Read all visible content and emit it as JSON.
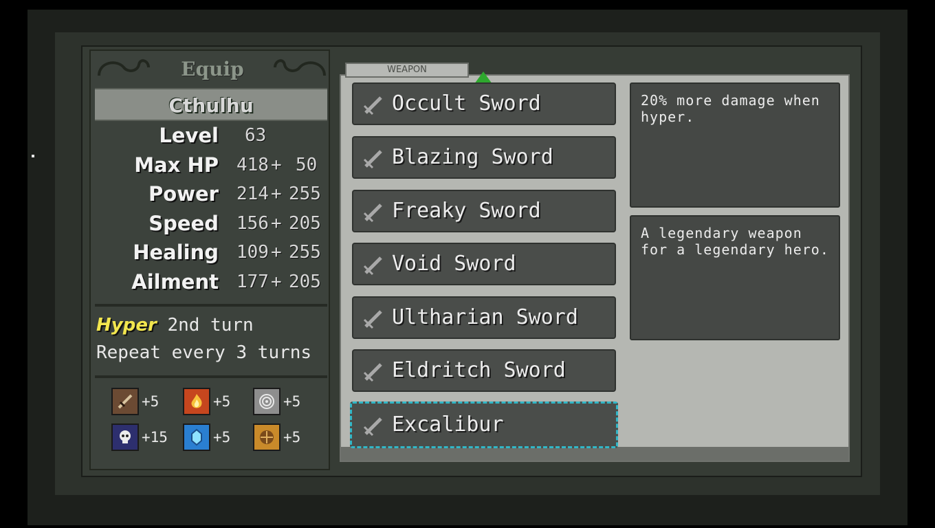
{
  "title": "Equip",
  "hero": {
    "name": "Cthulhu",
    "stats": [
      {
        "label": "Level",
        "base": "63",
        "plus": "",
        "bonus": ""
      },
      {
        "label": "Max HP",
        "base": "418",
        "plus": "+",
        "bonus": "50"
      },
      {
        "label": "Power",
        "base": "214",
        "plus": "+",
        "bonus": "255"
      },
      {
        "label": "Speed",
        "base": "156",
        "plus": "+",
        "bonus": "205"
      },
      {
        "label": "Healing",
        "base": "109",
        "plus": "+",
        "bonus": "255"
      },
      {
        "label": "Ailment",
        "base": "177",
        "plus": "+",
        "bonus": "205"
      }
    ],
    "hyper": {
      "tag": "Hyper",
      "turn": "2nd turn",
      "repeat": "Repeat every 3 turns"
    },
    "resistances": [
      {
        "icon": "sword-resist-icon",
        "value": "+5",
        "color": "#6b4a33"
      },
      {
        "icon": "fire-resist-icon",
        "value": "+5",
        "color": "#c6461e"
      },
      {
        "icon": "wind-resist-icon",
        "value": "+5",
        "color": "#8e8e8e"
      },
      {
        "icon": "skull-resist-icon",
        "value": "+15",
        "color": "#2d2f6e"
      },
      {
        "icon": "crystal-resist-icon",
        "value": "+5",
        "color": "#2a7fd1"
      },
      {
        "icon": "shield-resist-icon",
        "value": "+5",
        "color": "#c98a2a"
      }
    ]
  },
  "category_tab": "WEAPON",
  "items": [
    {
      "name": "Occult Sword",
      "selected": false
    },
    {
      "name": "Blazing Sword",
      "selected": false
    },
    {
      "name": "Freaky Sword",
      "selected": false
    },
    {
      "name": "Void Sword",
      "selected": false
    },
    {
      "name": "Ultharian Sword",
      "selected": false
    },
    {
      "name": "Eldritch Sword",
      "selected": false
    },
    {
      "name": "Excalibur",
      "selected": true
    }
  ],
  "description": {
    "effect": "20% more damage when hyper.",
    "flavor": "A legendary weapon for a legendary hero."
  },
  "colors": {
    "hyper_tag": "#f2e64e",
    "selection_outline": "#31b7c7",
    "tab_arrow": "#2ea82e"
  }
}
